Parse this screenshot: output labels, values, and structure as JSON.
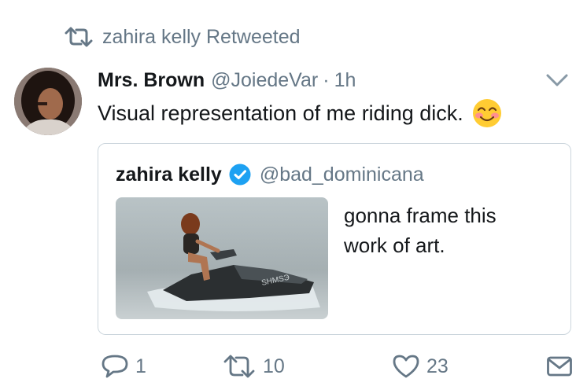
{
  "retweet_context": {
    "icon": "retweet-icon",
    "text": "zahira kelly Retweeted"
  },
  "tweet": {
    "author_name": "Mrs. Brown",
    "author_handle": "@JoiedeVar",
    "separator": "·",
    "time": "1h",
    "text": "Visual representation of me riding dick.",
    "emoji": "smiling-face-with-smiling-eyes-icon"
  },
  "quoted_tweet": {
    "author_name": "zahira kelly",
    "verified": true,
    "author_handle": "@bad_dominicana",
    "text_line1": "gonna frame this",
    "text_line2": "work of art.",
    "image_alt": "woman riding a jet ski on water"
  },
  "actions": {
    "reply_count": "1",
    "retweet_count": "10",
    "like_count": "23"
  },
  "colors": {
    "text": "#14171a",
    "secondary": "#657786",
    "border": "#ccd6dd",
    "verified": "#1da1f2"
  }
}
